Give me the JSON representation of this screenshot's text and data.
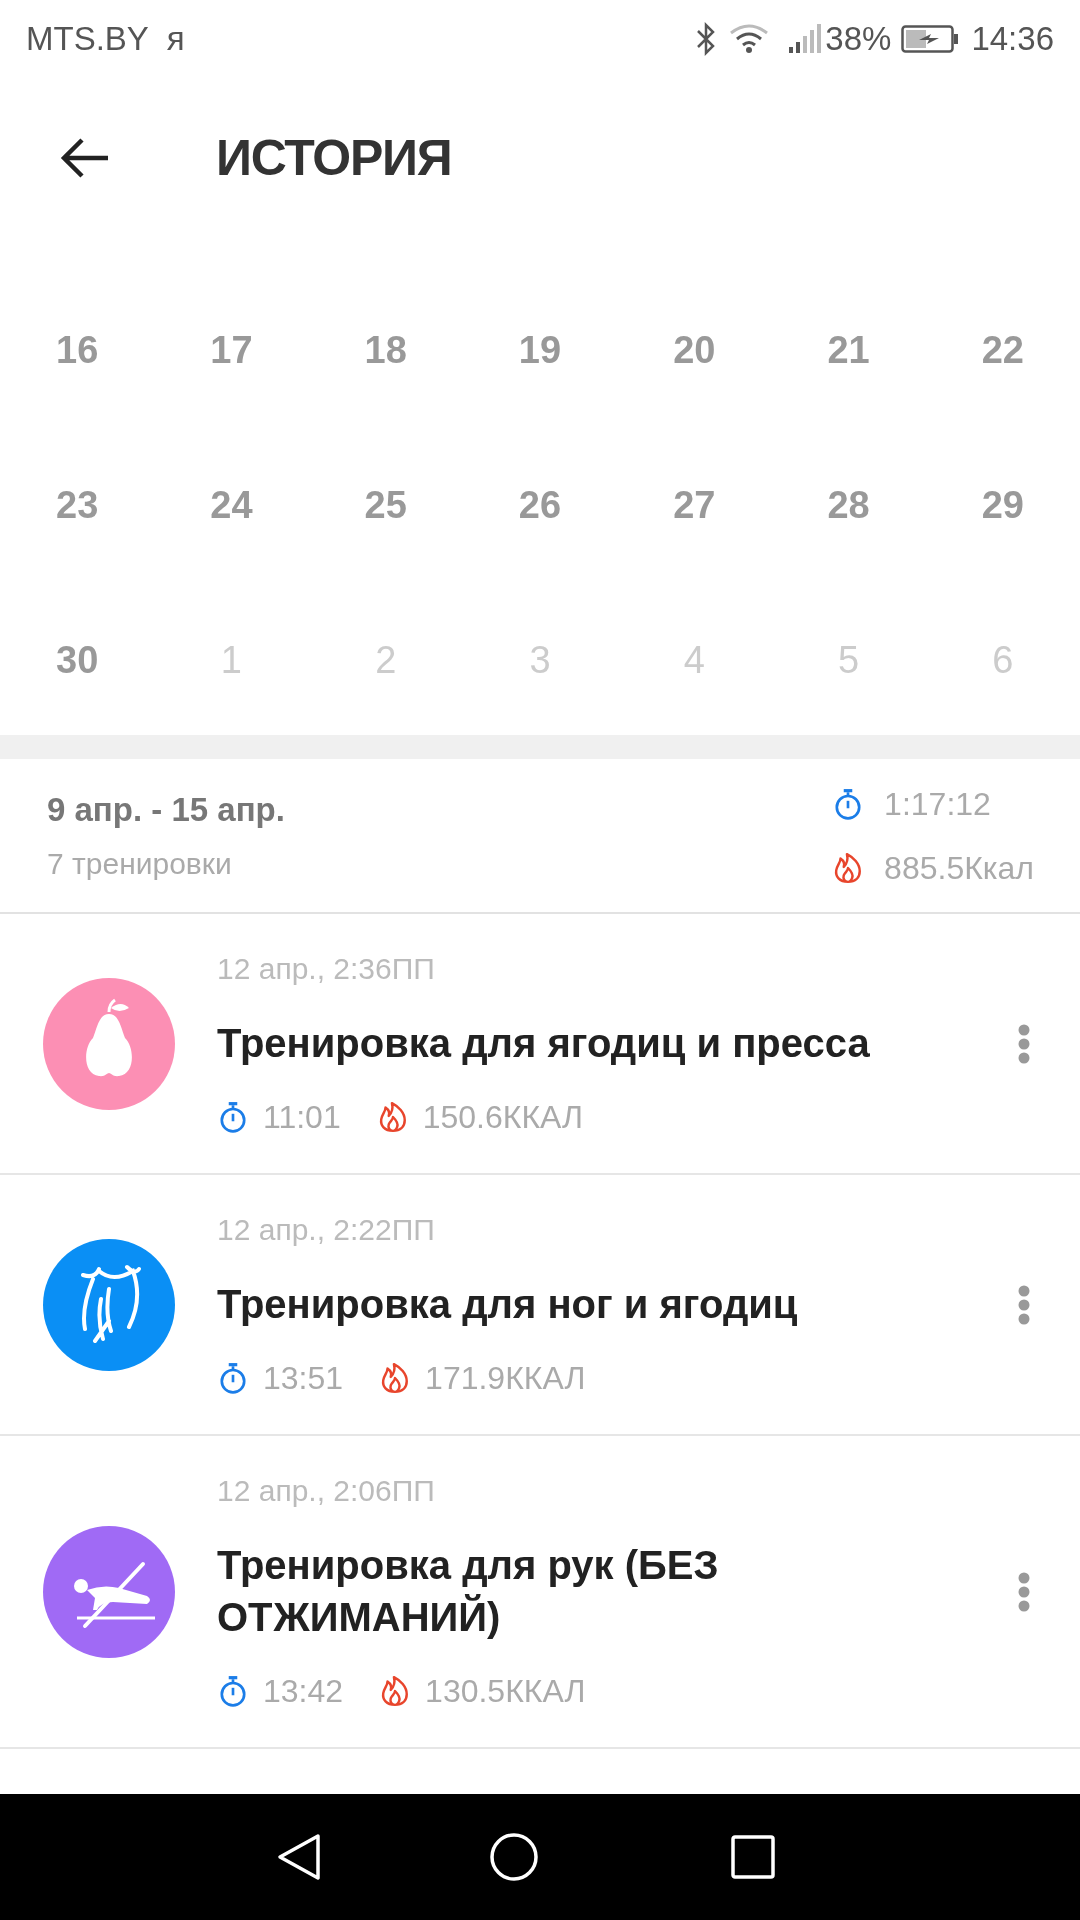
{
  "status_bar": {
    "carrier": "MTS.BY",
    "carrier_extra": "я",
    "battery": "38%",
    "time": "14:36"
  },
  "header": {
    "title": "ИСТОРИЯ"
  },
  "calendar": {
    "weeks": [
      [
        {
          "day": "16",
          "in_month": true
        },
        {
          "day": "17",
          "in_month": true
        },
        {
          "day": "18",
          "in_month": true
        },
        {
          "day": "19",
          "in_month": true
        },
        {
          "day": "20",
          "in_month": true
        },
        {
          "day": "21",
          "in_month": true
        },
        {
          "day": "22",
          "in_month": true
        }
      ],
      [
        {
          "day": "23",
          "in_month": true
        },
        {
          "day": "24",
          "in_month": true
        },
        {
          "day": "25",
          "in_month": true
        },
        {
          "day": "26",
          "in_month": true
        },
        {
          "day": "27",
          "in_month": true
        },
        {
          "day": "28",
          "in_month": true
        },
        {
          "day": "29",
          "in_month": true
        }
      ],
      [
        {
          "day": "30",
          "in_month": true
        },
        {
          "day": "1",
          "in_month": false
        },
        {
          "day": "2",
          "in_month": false
        },
        {
          "day": "3",
          "in_month": false
        },
        {
          "day": "4",
          "in_month": false
        },
        {
          "day": "5",
          "in_month": false
        },
        {
          "day": "6",
          "in_month": false
        }
      ]
    ]
  },
  "week_summary": {
    "range": "9 апр. - 15 апр.",
    "count": "7 тренировки",
    "duration": "1:17:12",
    "calories": "885.5Ккал"
  },
  "workouts": [
    {
      "kind": "pear",
      "color": "#fc8fb4",
      "date": "12 апр., 2:36ПП",
      "title": "Тренировка для ягодиц и пресса",
      "duration": "11:01",
      "calories": "150.6ККАЛ"
    },
    {
      "kind": "legs",
      "color": "#0a8ff5",
      "date": "12 апр., 2:22ПП",
      "title": "Тренировка для ног и ягодиц",
      "duration": "13:51",
      "calories": "171.9ККАЛ"
    },
    {
      "kind": "no_pushup",
      "color": "#a06af5",
      "date": "12 апр., 2:06ПП",
      "title": "Тренировка для рук (БЕЗ ОТЖИМАНИЙ)",
      "duration": "13:42",
      "calories": "130.5ККАЛ"
    }
  ]
}
